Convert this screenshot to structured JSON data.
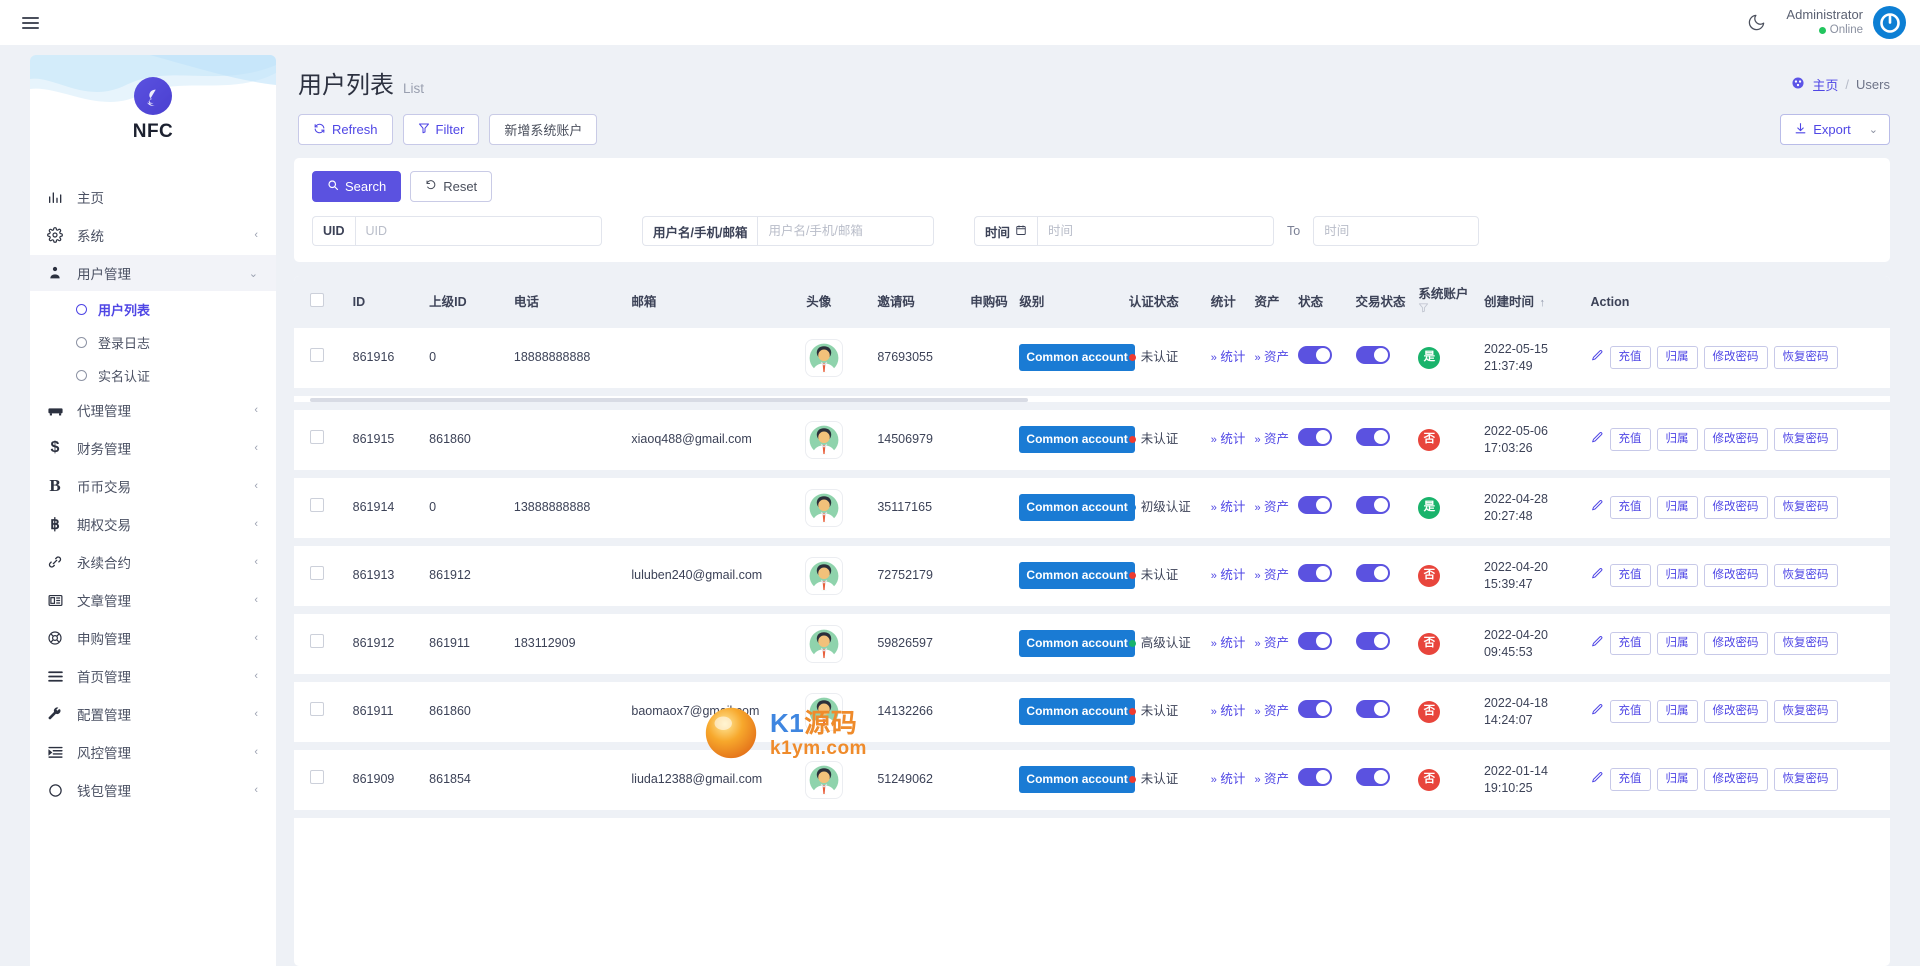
{
  "topbar": {
    "menu_icon": "hamburger-icon",
    "theme_icon": "moon-icon",
    "user_name": "Administrator",
    "user_status": "Online",
    "avatar_icon": "power-avatar-icon"
  },
  "sidebar": {
    "brand": "NFC",
    "items": [
      {
        "label": "主页",
        "icon": "chart-bar-icon",
        "arrow": "",
        "active": false
      },
      {
        "label": "系统",
        "icon": "gear-icon",
        "arrow": "‹",
        "active": false
      },
      {
        "label": "用户管理",
        "icon": "user-group-icon",
        "arrow": "⌄",
        "active": true
      },
      {
        "label": "代理管理",
        "icon": "agent-icon",
        "arrow": "‹",
        "active": false
      },
      {
        "label": "财务管理",
        "icon": "dollar-icon",
        "arrow": "‹",
        "active": false
      },
      {
        "label": "币币交易",
        "icon": "letter-b-icon",
        "arrow": "‹",
        "active": false
      },
      {
        "label": "期权交易",
        "icon": "bitcoin-icon",
        "arrow": "‹",
        "active": false
      },
      {
        "label": "永续合约",
        "icon": "link-chain-icon",
        "arrow": "‹",
        "active": false
      },
      {
        "label": "文章管理",
        "icon": "article-icon",
        "arrow": "‹",
        "active": false
      },
      {
        "label": "申购管理",
        "icon": "lifebuoy-icon",
        "arrow": "‹",
        "active": false
      },
      {
        "label": "首页管理",
        "icon": "lines-icon",
        "arrow": "‹",
        "active": false
      },
      {
        "label": "配置管理",
        "icon": "wrench-icon",
        "arrow": "‹",
        "active": false
      },
      {
        "label": "风控管理",
        "icon": "indent-icon",
        "arrow": "‹",
        "active": false
      },
      {
        "label": "钱包管理",
        "icon": "circle-icon",
        "arrow": "‹",
        "active": false
      }
    ],
    "submenu": [
      {
        "label": "用户列表",
        "active": true
      },
      {
        "label": "登录日志",
        "active": false
      },
      {
        "label": "实名认证",
        "active": false
      }
    ]
  },
  "page": {
    "title_cn": "用户列表",
    "title_en": "List",
    "breadcrumb_home": "主页",
    "breadcrumb_sep": "/",
    "breadcrumb_current": "Users",
    "home_icon": "dashboard-icon"
  },
  "toolbar": {
    "refresh": "Refresh",
    "filter": "Filter",
    "add_system_account": "新增系统账户",
    "export": "Export",
    "export_caret": "⌄",
    "refresh_icon": "refresh-icon",
    "filter_icon": "funnel-icon",
    "export_icon": "download-icon"
  },
  "search_panel": {
    "search_label": "Search",
    "reset_label": "Reset",
    "search_icon": "magnifier-icon",
    "reset_icon": "undo-icon",
    "fields": [
      {
        "addon": "UID",
        "placeholder": "UID",
        "value": ""
      },
      {
        "addon": "用户名/手机/邮箱",
        "placeholder": "用户名/手机/邮箱",
        "value": ""
      },
      {
        "addon": "时间",
        "addon_icon": "calendar-icon",
        "placeholder": "时间",
        "value": ""
      }
    ],
    "to_label": "To",
    "end_time_placeholder": "时间"
  },
  "table": {
    "columns": [
      "ID",
      "上级ID",
      "电话",
      "邮箱",
      "头像",
      "邀请码",
      "申购码",
      "级别",
      "认证状态",
      "统计",
      "资产",
      "状态",
      "交易状态",
      "系统账户",
      "创建时间",
      "Action"
    ],
    "sort_indicator": "↑",
    "filter_icon": "funnel-icon",
    "stat_link": "统计",
    "asset_link": "资产",
    "link_chevron": "»",
    "actions": {
      "edit_icon": "pencil-icon",
      "recharge": "充值",
      "attribution": "归属",
      "change_password": "修改密码",
      "restore_password": "恢复密码"
    },
    "rows": [
      {
        "id": "861916",
        "parent_id": "0",
        "phone": "18888888888",
        "email": "",
        "invite_code": "87693055",
        "purchase_code": "",
        "level": "Common account",
        "auth_status": "未认证",
        "auth_color": "#ee3b30",
        "system_account": "是",
        "system_account_type": "yes",
        "created": "2022-05-15 21:37:49"
      },
      {
        "id": "861915",
        "parent_id": "861860",
        "phone": "",
        "email": "xiaoq488@gmail.com",
        "invite_code": "14506979",
        "purchase_code": "",
        "level": "Common account",
        "auth_status": "未认证",
        "auth_color": "#ee3b30",
        "system_account": "否",
        "system_account_type": "no",
        "created": "2022-05-06 17:03:26"
      },
      {
        "id": "861914",
        "parent_id": "0",
        "phone": "13888888888",
        "email": "",
        "invite_code": "35117165",
        "purchase_code": "",
        "level": "Common account",
        "auth_status": "初级认证",
        "auth_color": "#1a7bd4",
        "system_account": "是",
        "system_account_type": "yes",
        "created": "2022-04-28 20:27:48"
      },
      {
        "id": "861913",
        "parent_id": "861912",
        "phone": "",
        "email": "luluben240@gmail.com",
        "invite_code": "72752179",
        "purchase_code": "",
        "level": "Common account",
        "auth_status": "未认证",
        "auth_color": "#ee3b30",
        "system_account": "否",
        "system_account_type": "no",
        "created": "2022-04-20 15:39:47"
      },
      {
        "id": "861912",
        "parent_id": "861911",
        "phone": "183112909",
        "email": "",
        "invite_code": "59826597",
        "purchase_code": "",
        "level": "Common account",
        "auth_status": "高级认证",
        "auth_color": "#19b36b",
        "system_account": "否",
        "system_account_type": "no",
        "created": "2022-04-20 09:45:53"
      },
      {
        "id": "861911",
        "parent_id": "861860",
        "phone": "",
        "email": "baomaox7@gmail.com",
        "invite_code": "14132266",
        "purchase_code": "",
        "level": "Common account",
        "auth_status": "未认证",
        "auth_color": "#ee3b30",
        "system_account": "否",
        "system_account_type": "no",
        "created": "2022-04-18 14:24:07"
      },
      {
        "id": "861909",
        "parent_id": "861854",
        "phone": "",
        "email": "liuda12388@gmail.com",
        "invite_code": "51249062",
        "purchase_code": "",
        "level": "Common account",
        "auth_status": "未认证",
        "auth_color": "#ee3b30",
        "system_account": "否",
        "system_account_type": "no",
        "created": "2022-01-14 19:10:25"
      }
    ]
  },
  "watermark": {
    "text_main": "K1",
    "text_rest": "源码",
    "text_domain": "k1ym.com"
  },
  "colors": {
    "accent": "#5b52e0",
    "link": "#4f46e5",
    "badge_blue": "#1a7bd4",
    "green": "#19b36b",
    "red": "#e8453c"
  }
}
